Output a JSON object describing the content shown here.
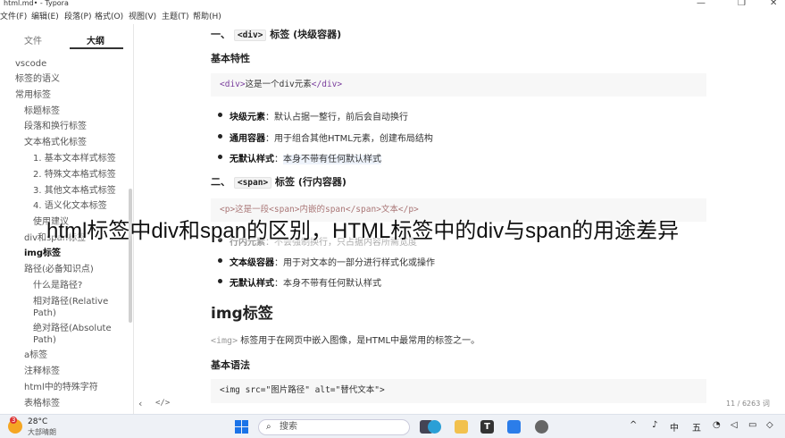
{
  "titlebar": {
    "title": "html.md• - Typora"
  },
  "menu": [
    "文件(F)",
    "编辑(E)",
    "段落(P)",
    "格式(O)",
    "视图(V)",
    "主题(T)",
    "帮助(H)"
  ],
  "sidebar": {
    "tabs": [
      "文件",
      "大纲"
    ],
    "toc": [
      "vscode",
      "标签的语义",
      "常用标签",
      "标题标签",
      "段落和换行标签",
      "文本格式化标签",
      "1. 基本文本样式标签",
      "2. 特殊文本格式标签",
      "3. 其他文本格式标签",
      "4. 语义化文本标签",
      "使用建议",
      "div和span标签",
      "img标签",
      "路径(必备知识点)",
      "什么是路径?",
      "相对路径(Relative",
      "Path)",
      "绝对路径(Absolute",
      "Path)",
      "a标签",
      "注释标签",
      "html中的特殊字符",
      "表格标签"
    ]
  },
  "main": {
    "sec1_prefix": "一、",
    "sec1_tag": "<div>",
    "sec1_rest": " 标签 (块级容器)",
    "basic_features": "基本特性",
    "code1_open": "<div>",
    "code1_text": "这是一个div元素",
    "code1_close": "</div>",
    "b1_bold": "块级元素",
    "b1_rest": "：默认占据一整行，前后会自动换行",
    "b2_bold": "通用容器",
    "b2_rest": "：用于组合其他HTML元素，创建布局结构",
    "b3_bold": "无默认样式",
    "b3_colon": "：",
    "b3_rest": "本身不带有任何默认样式",
    "sec2_prefix": "二、",
    "sec2_tag": "<span>",
    "sec2_rest": " 标签 (行内容器)",
    "code2": "<p>这是一段<span>内嵌的span</span>文本</p>",
    "b4_bold": "行内元素",
    "b4_rest": "：不会强制换行，只占据内容所需宽度",
    "b5_bold": "文本级容器",
    "b5_rest": "：用于对文本的一部分进行样式化或操作",
    "b6_bold": "无默认样式",
    "b6_rest": "：本身不带有任何默认样式",
    "img_heading": "img标签",
    "img_code": "<img>",
    "img_desc": " 标签用于在网页中嵌入图像，是HTML中最常用的标签之一。",
    "basic_syntax": "基本语法",
    "code3": "<img src=\"图片路径\" alt=\"替代文本\">",
    "wordcount": "11 / 6263 词"
  },
  "overlay_text": "html标签中div和span的区别，HTML标签中的div与span的用途差异",
  "taskbar": {
    "weather_temp": "28°C",
    "weather_desc": "大部晴朗",
    "badge": "3",
    "search": "搜索",
    "ime_zh": "中",
    "ime_wu": "五"
  }
}
